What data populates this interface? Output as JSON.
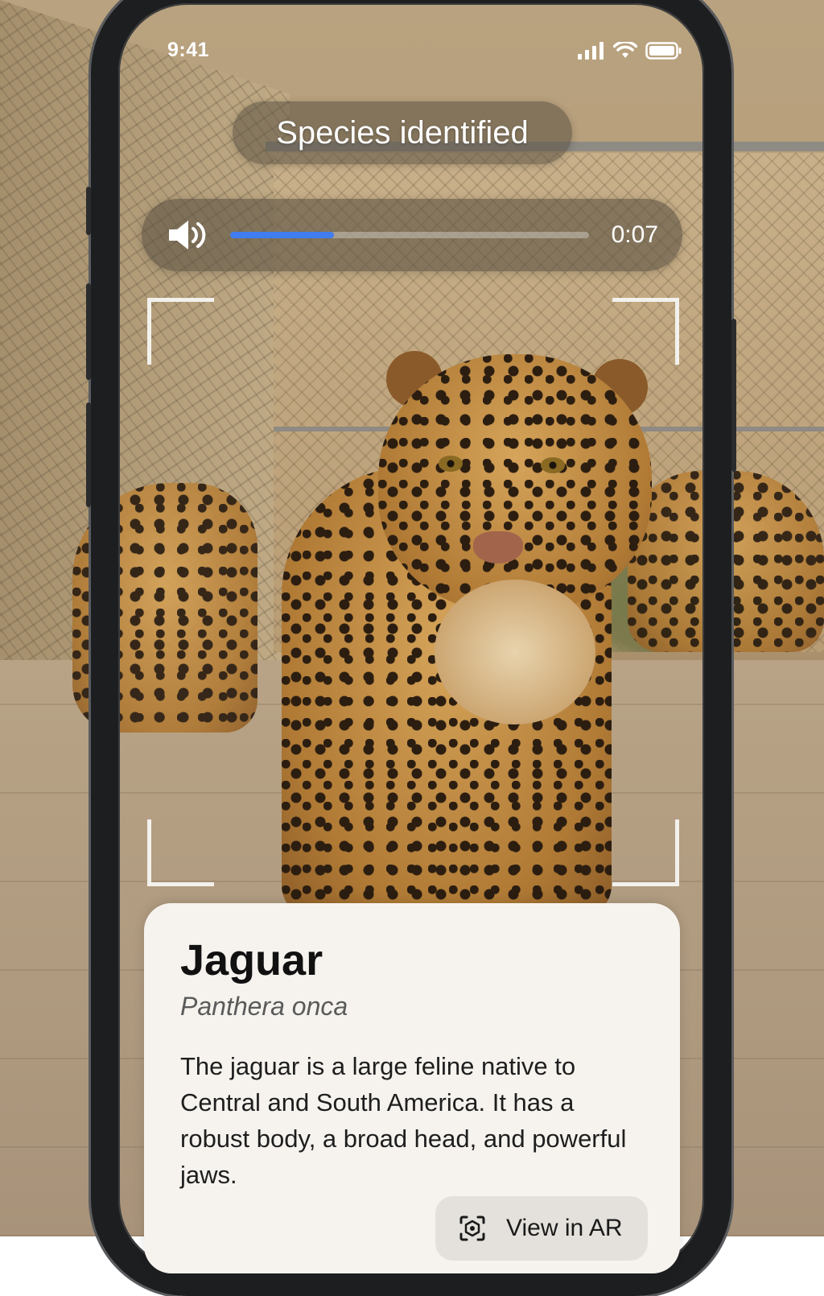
{
  "status_bar": {
    "time": "9:41",
    "signal_icon": "cellular-signal-icon",
    "wifi_icon": "wifi-icon",
    "battery_icon": "battery-icon"
  },
  "banner": {
    "label": "Species identified"
  },
  "audio_player": {
    "icon": "speaker-icon",
    "progress_fraction": 0.29,
    "time": "0:07",
    "progress_color": "#3f7df0"
  },
  "species_card": {
    "common_name": "Jaguar",
    "scientific_name": "Panthera onca",
    "description": "The jaguar is a large feline native to Central and South America. It has a robust body, a broad head, and powerful jaws.",
    "ar_button": {
      "icon": "ar-cube-icon",
      "label": "View in AR"
    }
  }
}
